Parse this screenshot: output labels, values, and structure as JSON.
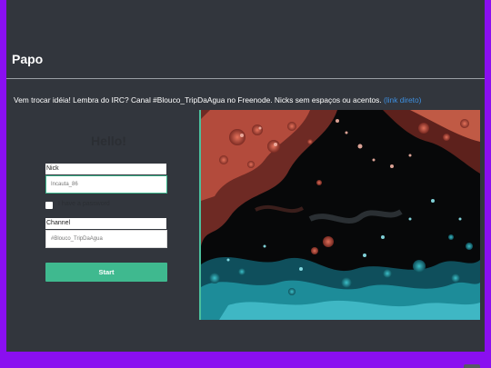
{
  "page": {
    "title": "Papo"
  },
  "intro": {
    "text": "Vem trocar idéia! Lembra do IRC? Canal #Blouco_TripDaAgua no Freenode. Nicks sem espaços ou acentos. ",
    "link_text": "(link direto)"
  },
  "login": {
    "heading": "Hello!",
    "nick_label": "Nick",
    "nick_value": "Incauta_86",
    "password_checkbox_label": "I have a password",
    "channel_label": "Channel",
    "channel_value": "#Blouco_TripDaAgua",
    "start_label": "Start"
  },
  "colors": {
    "page_background": "#8a0ff0",
    "panel_background": "#32363d",
    "accent": "#3fb98f",
    "link": "#3d8fe0"
  }
}
